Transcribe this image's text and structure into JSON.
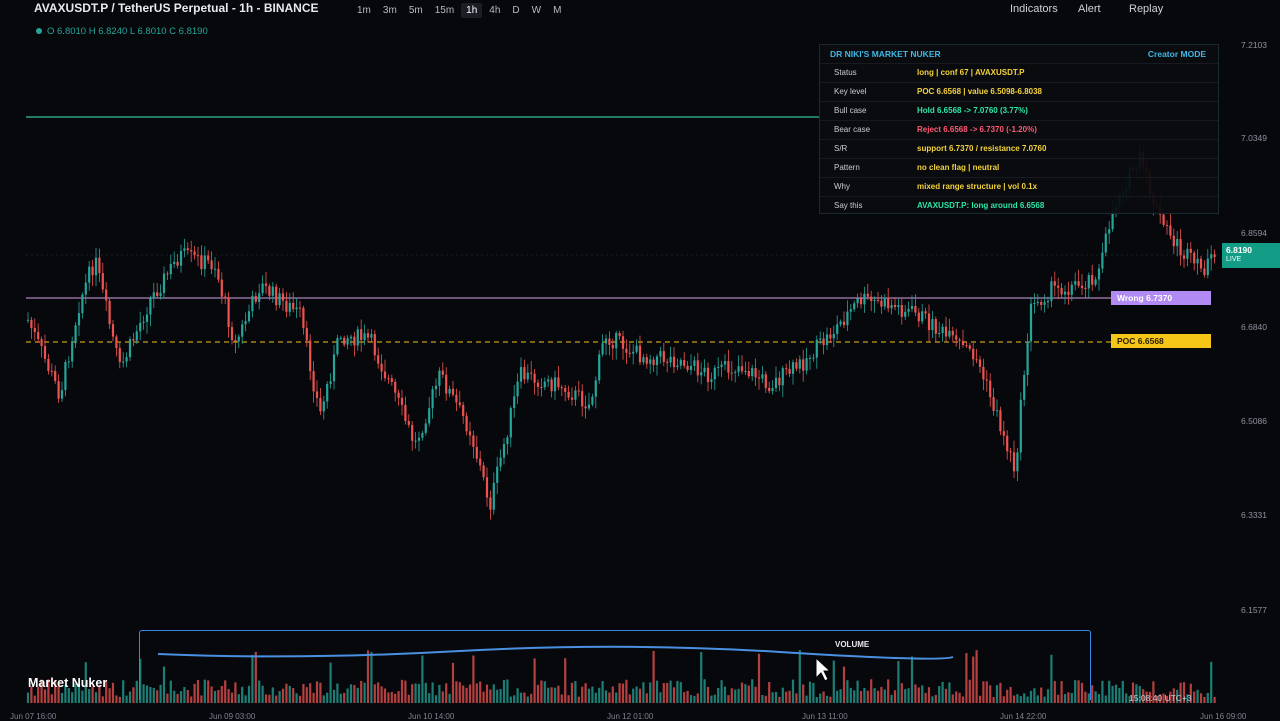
{
  "header": {
    "symbol_title": "AVAXUSDT.P / TetherUS Perpetual - 1h - BINANCE",
    "timeframes": [
      "1m",
      "3m",
      "5m",
      "15m",
      "1h",
      "4h",
      "D",
      "W",
      "M"
    ],
    "active_timeframe": "1h",
    "menu": {
      "indicators": "Indicators",
      "alert": "Alert",
      "replay": "Replay"
    }
  },
  "ohlc": "O 6.8010 H 6.8240 L 6.8010 C 6.8190",
  "price_axis": [
    "7.2103",
    "7.0349",
    "6.8594",
    "6.6840",
    "6.5086",
    "6.3331",
    "6.1577"
  ],
  "date_axis": [
    "Jun 07 16:00",
    "Jun 09 03:00",
    "Jun 10 14:00",
    "Jun 12 01:00",
    "Jun 13 11:00",
    "Jun 14 22:00",
    "Jun 16 09:00"
  ],
  "level_tags": {
    "wrong": "Wrong 6.7370",
    "poc": "POC 6.6568"
  },
  "last_price": {
    "value": "6.8190",
    "badge": "LIVE"
  },
  "panel": {
    "title": "DR NIKI'S MARKET NUKER",
    "mode": "Creator MODE",
    "rows": [
      {
        "key": "Status",
        "value": "long | conf 67 | AVAXUSDT.P",
        "color": "#f5d33b"
      },
      {
        "key": "Key level",
        "value": "POC 6.6568 | value 6.5098-6.8038",
        "color": "#f5d33b"
      },
      {
        "key": "Bull case",
        "value": "Hold 6.6568 -> 7.0760 (3.77%)",
        "color": "#2ee6a8"
      },
      {
        "key": "Bear case",
        "value": "Reject 6.6568 -> 6.7370 (-1.20%)",
        "color": "#ff5a73"
      },
      {
        "key": "S/R",
        "value": "support 6.7370 / resistance 7.0760",
        "color": "#f5d33b"
      },
      {
        "key": "Pattern",
        "value": "no clean flag | neutral",
        "color": "#f5d33b"
      },
      {
        "key": "Why",
        "value": "mixed range structure | vol 0.1x",
        "color": "#f5d33b"
      },
      {
        "key": "Say this",
        "value": "AVAXUSDT.P: long around 6.6568",
        "color": "#2ee6a8"
      }
    ]
  },
  "volume_label": "VOLUME",
  "brand": "Market Nuker",
  "clock": "15:08:40 UTC+3",
  "colors": {
    "up": "#26a69a",
    "down": "#ef5350",
    "poc_line": "#f5c518",
    "wrong_line": "#d4a0e6",
    "resistance_line": "#2fbf98"
  },
  "icons": {
    "cursor": "arrow-cursor-icon"
  }
}
